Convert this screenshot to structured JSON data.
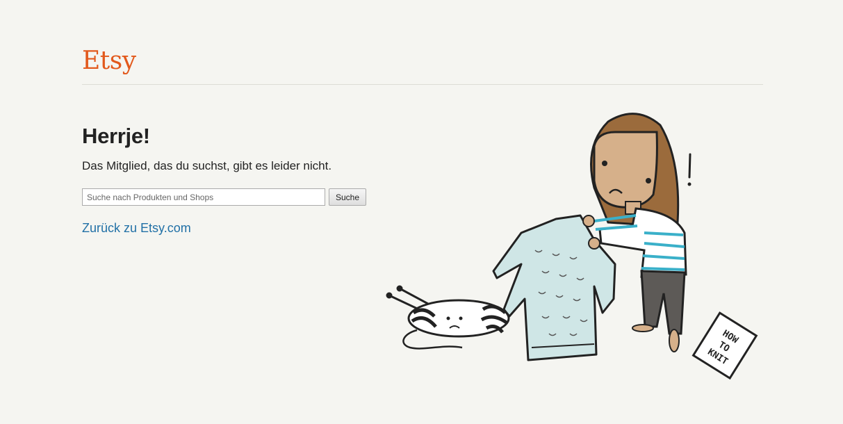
{
  "header": {
    "logo_text": "Etsy"
  },
  "main": {
    "title": "Herrje!",
    "message": "Das Mitglied, das du suchst, gibt es leider nicht.",
    "search": {
      "placeholder": "Suche nach Produkten und Shops",
      "value": "",
      "button_label": "Suche"
    },
    "back_link": "Zurück zu Etsy.com"
  },
  "illustration": {
    "booklet_text": [
      "HOW",
      "TO",
      "KNIT"
    ]
  },
  "colors": {
    "brand": "#e2591c",
    "link": "#2170a6",
    "background": "#f5f5f1"
  }
}
